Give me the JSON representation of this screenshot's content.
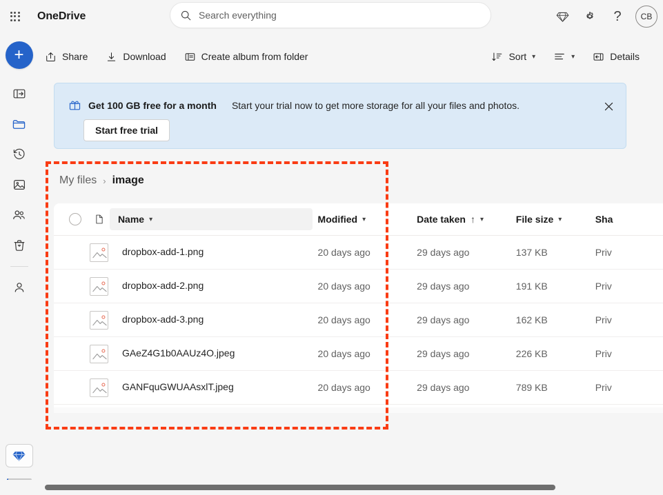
{
  "suite": {
    "waffle_label": "app-launcher",
    "brand": "OneDrive",
    "search": {
      "placeholder": "Search everything",
      "value": ""
    },
    "premium_icon": "diamond-icon",
    "settings_icon": "gear-icon",
    "help_label": "?",
    "avatar_initials": "CB"
  },
  "rail": {
    "new_label": "+",
    "items": [
      {
        "icon": "panel-expand-icon",
        "label": "Expand navigation"
      },
      {
        "icon": "folder-icon",
        "label": "My files",
        "active": true
      },
      {
        "icon": "history-icon",
        "label": "Recent"
      },
      {
        "icon": "photos-icon",
        "label": "Photos"
      },
      {
        "icon": "people-icon",
        "label": "Shared"
      },
      {
        "icon": "recycle-bin-icon",
        "label": "Recycle bin"
      },
      {
        "icon": "person-icon",
        "label": "Browse files by"
      }
    ],
    "premium_icon": "diamond-icon",
    "storage_percent": 8
  },
  "commandbar": {
    "share": "Share",
    "download": "Download",
    "create_album": "Create album from folder",
    "sort": "Sort",
    "details": "Details",
    "view_icon": "list-view-icon"
  },
  "banner": {
    "icon": "gift-icon",
    "title": "Get 100 GB free for a month",
    "subtitle": "Start your trial now to get more storage for all your files and photos.",
    "button": "Start free trial",
    "close_icon": "close-icon"
  },
  "breadcrumb": {
    "root": "My files",
    "separator": "›",
    "current": "image"
  },
  "table": {
    "columns": {
      "name": "Name",
      "modified": "Modified",
      "date_taken": "Date taken",
      "file_size": "File size",
      "sharing": "Sha"
    },
    "sort_indicator": "↑",
    "rows": [
      {
        "icon": "image-file-icon",
        "name": "dropbox-add-1.png",
        "modified": "20 days ago",
        "date_taken": "29 days ago",
        "file_size": "137 KB",
        "sharing": "Priv"
      },
      {
        "icon": "image-file-icon",
        "name": "dropbox-add-2.png",
        "modified": "20 days ago",
        "date_taken": "29 days ago",
        "file_size": "191 KB",
        "sharing": "Priv"
      },
      {
        "icon": "image-file-icon",
        "name": "dropbox-add-3.png",
        "modified": "20 days ago",
        "date_taken": "29 days ago",
        "file_size": "162 KB",
        "sharing": "Priv"
      },
      {
        "icon": "image-file-icon",
        "name": "GAeZ4G1b0AAUz4O.jpeg",
        "modified": "20 days ago",
        "date_taken": "29 days ago",
        "file_size": "226 KB",
        "sharing": "Priv"
      },
      {
        "icon": "image-file-icon",
        "name": "GANFquGWUAAsxlT.jpeg",
        "modified": "20 days ago",
        "date_taken": "29 days ago",
        "file_size": "789 KB",
        "sharing": "Priv"
      }
    ]
  },
  "annotation": {
    "color": "#fa3c14",
    "style": "dashed-rectangle"
  },
  "colors": {
    "accent": "#2563c9",
    "banner_bg": "#dceaf7",
    "page_bg": "#f5f5f5",
    "highlight": "#fa3c14"
  }
}
